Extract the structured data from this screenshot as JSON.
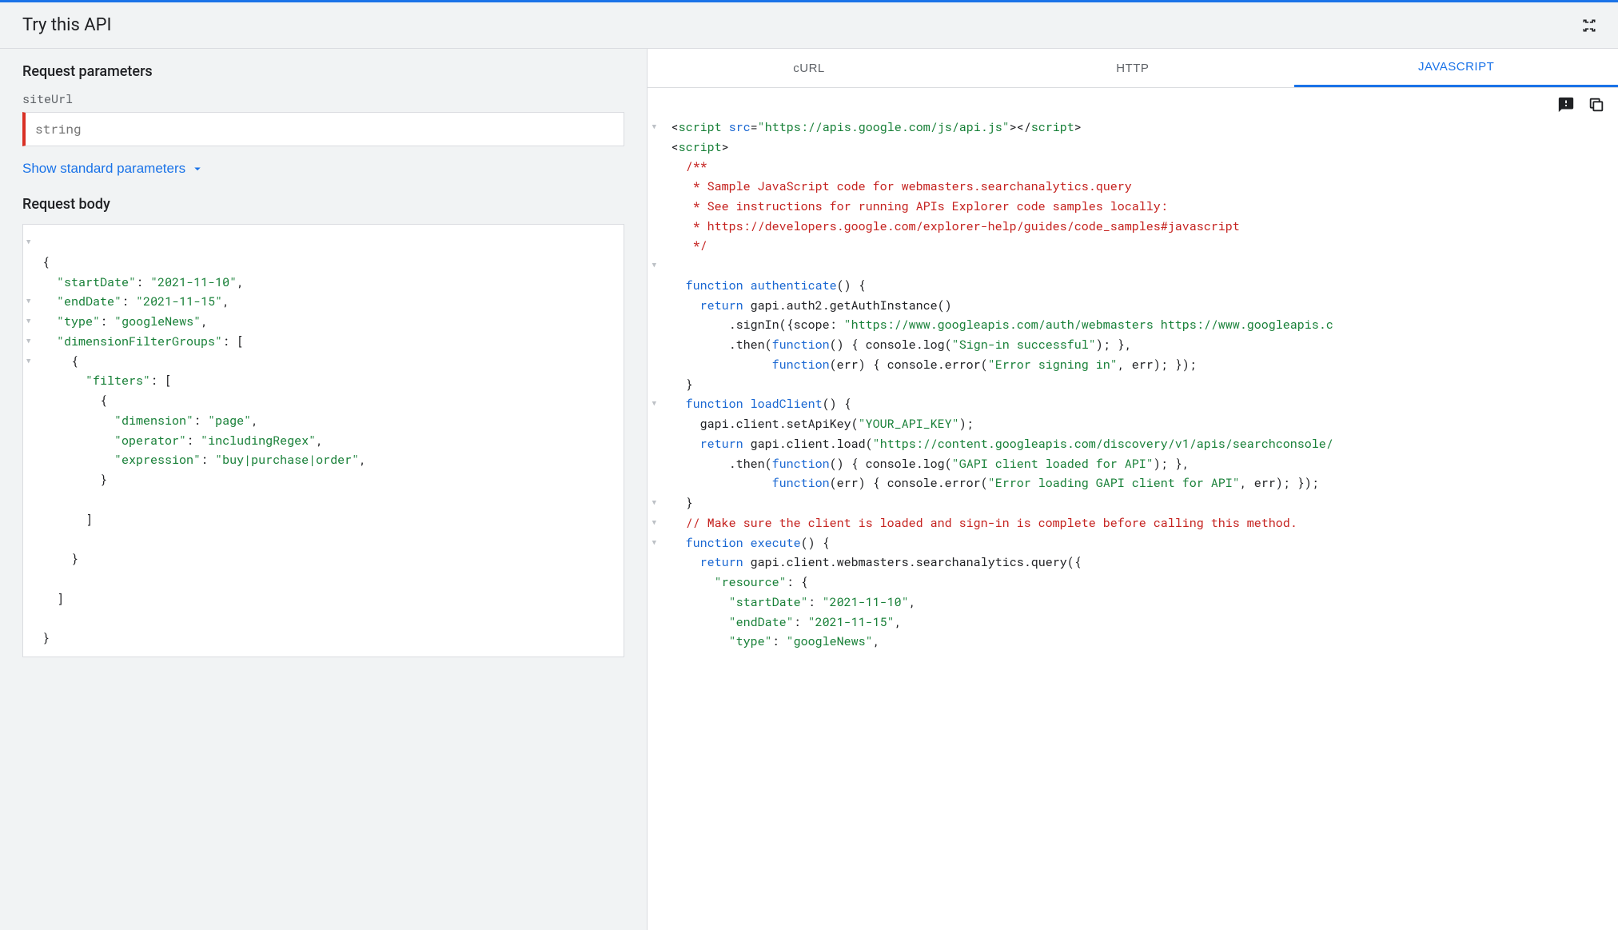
{
  "header": {
    "title": "Try this API"
  },
  "leftPanel": {
    "paramsHeading": "Request parameters",
    "siteUrlLabel": "siteUrl",
    "siteUrlPlaceholder": "string",
    "showStandard": "Show standard parameters",
    "bodyHeading": "Request body",
    "body": {
      "startDate": "2021-11-10",
      "endDate": "2021-11-15",
      "type": "googleNews",
      "dimensionFilterGroups": [
        {
          "filters": [
            {
              "dimension": "page",
              "operator": "includingRegex",
              "expression": "buy|purchase|order"
            }
          ]
        }
      ]
    }
  },
  "tabs": {
    "curl": "cURL",
    "http": "HTTP",
    "js": "JAVASCRIPT"
  },
  "code": {
    "scriptSrc": "https://apis.google.com/js/api.js",
    "commentL1": "/**",
    "commentL2": " * Sample JavaScript code for webmasters.searchanalytics.query",
    "commentL3": " * See instructions for running APIs Explorer code samples locally:",
    "commentL4": " * https://developers.google.com/explorer-help/guides/code_samples#javascript",
    "commentL5": " */",
    "authScope": "https://www.googleapis.com/auth/webmasters https://www.googleapis.c",
    "signInOk": "Sign-in successful",
    "signInErr": "Error signing in",
    "apiKey": "YOUR_API_KEY",
    "discoveryUrl": "https://content.googleapis.com/discovery/v1/apis/searchconsole/",
    "gapiLoaded": "GAPI client loaded for API",
    "gapiLoadErr": "Error loading GAPI client for API",
    "makeSelect": "// Make sure the client is loaded and sign-in is complete before calling this method.",
    "resStartDate": "2021-11-10",
    "resEndDate": "2021-11-15",
    "resType": "googleNews"
  }
}
